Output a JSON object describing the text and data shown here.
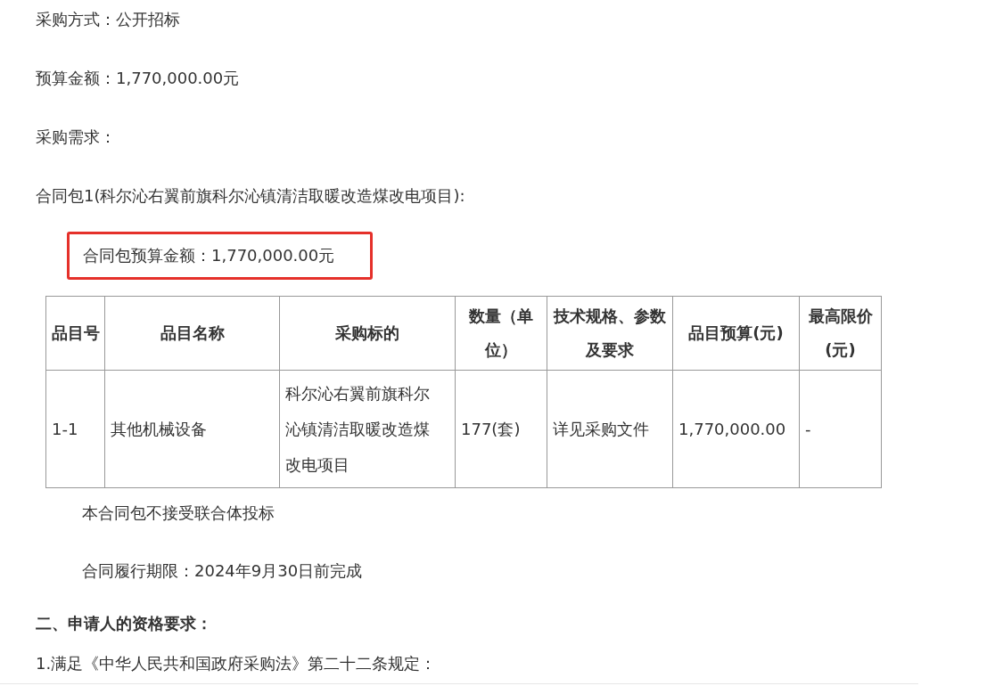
{
  "top_lines": [
    "采购方式：公开招标",
    "预算金额：1,770,000.00元",
    "采购需求：",
    "合同包1(科尔沁右翼前旗科尔沁镇清洁取暖改造煤改电项目):"
  ],
  "package_budget": {
    "text": "合同包预算金额：1,770,000.00元",
    "highlighted": true
  },
  "table": {
    "columns": [
      "品目号",
      "品目名称",
      "采购标的",
      "数量（单位）",
      "技术规格、参数及要求",
      "品目预算(元)",
      "最高限价(元)"
    ],
    "rows": [
      [
        "1-1",
        "其他机械设备",
        "科尔沁右翼前旗科尔沁镇清洁取暖改造煤改电项目",
        "177(套)",
        "详见采购文件",
        "1,770,000.00",
        "-"
      ]
    ]
  },
  "notes": [
    "本合同包不接受联合体投标",
    "合同履行期限：2024年9月30日前完成"
  ],
  "section_heading": "二、申请人的资格要求：",
  "requirements": [
    "1.满足《中华人民共和国政府采购法》第二十二条规定："
  ]
}
